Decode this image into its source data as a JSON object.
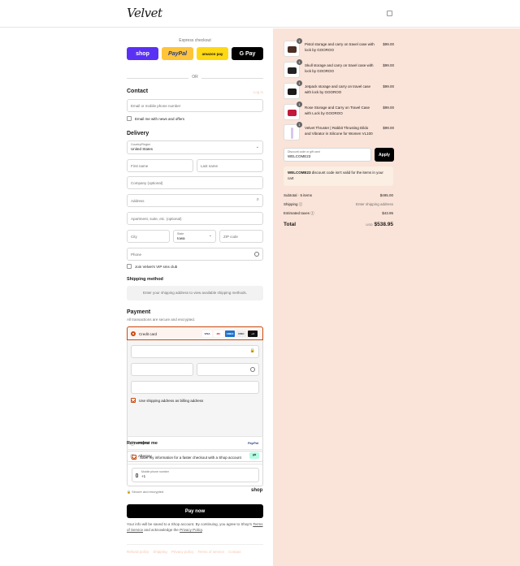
{
  "brand": {
    "name": "Velvet"
  },
  "express": {
    "title": "Express checkout",
    "shop": "shop",
    "paypal": "PayPal",
    "amazon": "amazon pay",
    "gpay": "G Pay",
    "or": "OR"
  },
  "contact": {
    "title": "Contact",
    "login": "Log in",
    "email_placeholder": "Email or mobile phone number",
    "news_label": "Email me with news and offers"
  },
  "delivery": {
    "title": "Delivery",
    "country_label": "Country/Region",
    "country_value": "United States",
    "first_name": "First name",
    "last_name": "Last name",
    "company": "Company (optional)",
    "address": "Address",
    "apartment": "Apartment, suite, etc. (optional)",
    "city": "City",
    "state_label": "State",
    "state_value": "Iowa",
    "zip": "ZIP code",
    "phone": "Phone",
    "vip_label": "Join Velvet's VIP sms club"
  },
  "shipping": {
    "title": "Shipping method",
    "note": "Enter your shipping address to view available shipping methods."
  },
  "payment": {
    "title": "Payment",
    "subtitle": "All transactions are secure and encrypted.",
    "credit_card": "Credit card",
    "card_brands": [
      "VISA",
      "MC",
      "AMEX",
      "DISC",
      "+4"
    ],
    "billing_label": "Use shipping address as billing address",
    "paypal": "PayPal",
    "paypal_logo": "PayPal",
    "afterpay": "Afterpay"
  },
  "remember": {
    "title": "Remember me",
    "save_label": "Save my information for a faster checkout with a Shop account",
    "mobile_label": "Mobile phone number",
    "mobile_value": "+1",
    "secure": "Secure and encrypted",
    "shop_logo": "shop"
  },
  "paynow": {
    "label": "Pay now",
    "legal_1": "Your info will be saved to a Shop account. By continuing, you agree to Shop's",
    "terms": "Terms of Service",
    "legal_2": "and acknowledge the",
    "privacy": "Privacy Policy",
    "legal_3": "."
  },
  "footer_links": [
    "Refund policy",
    "Shipping",
    "Privacy policy",
    "Terms of service",
    "Contact"
  ],
  "cart": {
    "items": [
      {
        "name": "Pistol storage and carry on travel case with lock by GOOROO",
        "price": "$99.00",
        "qty": "1"
      },
      {
        "name": "Skull storage and carry on travel case with lock by GOOROO",
        "price": "$99.00",
        "qty": "1"
      },
      {
        "name": "Jetpack storage and carry on travel case with lock by GOOROO",
        "price": "$99.00",
        "qty": "1"
      },
      {
        "name": "Rose Storage and Carry on Travel Case with Lock by GOOROO",
        "price": "$99.00",
        "qty": "1"
      },
      {
        "name": "Velvet Thruster | Rabbit Thrusting Dildo and Vibrator in Silicone for Women VL100",
        "price": "$99.00",
        "qty": "1"
      }
    ],
    "discount_label": "Discount code or gift card",
    "discount_value": "WELCOME23",
    "apply": "Apply",
    "notice_code": "WELCOME23",
    "notice_text": " discount code isn't valid for the items in your cart",
    "subtotal_label": "Subtotal · 5 items",
    "subtotal_value": "$495.00",
    "shipping_label": "Shipping",
    "shipping_value": "Enter shipping address",
    "taxes_label": "Estimated taxes",
    "taxes_value": "$43.95",
    "total_label": "Total",
    "currency": "USD",
    "total_value": "$538.95"
  },
  "colors": {
    "accent": "#c84a0f",
    "shop": "#5a31f4",
    "paypal": "#ffc439",
    "amazon": "#ffd814",
    "summary_bg": "#fae3d8"
  }
}
